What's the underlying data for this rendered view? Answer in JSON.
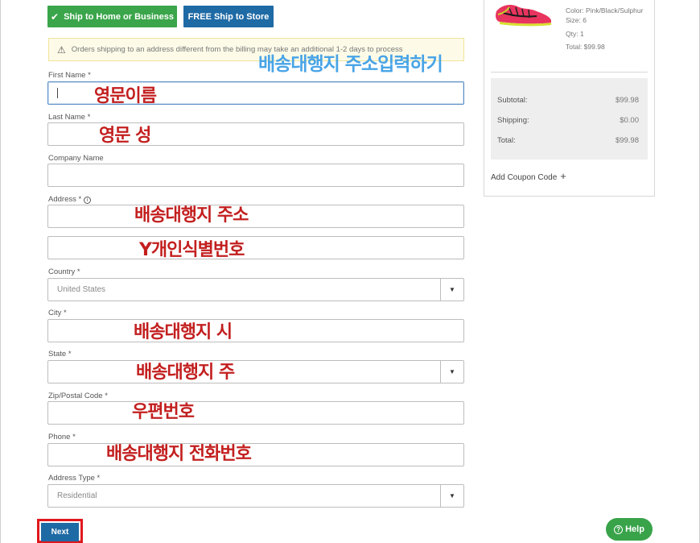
{
  "shipping_options": {
    "home_label": "Ship to Home or Business",
    "store_label": "FREE Ship to Store"
  },
  "notice": {
    "text": "Orders shipping to an address different from the billing may take an additional 1-2 days to process"
  },
  "form": {
    "first_name_label": "First Name *",
    "last_name_label": "Last Name *",
    "company_label": "Company Name",
    "address_label": "Address *",
    "country_label": "Country *",
    "country_value": "United States",
    "city_label": "City *",
    "state_label": "State *",
    "zip_label": "Zip/Postal Code *",
    "phone_label": "Phone *",
    "address_type_label": "Address Type *",
    "address_type_value": "Residential",
    "next_label": "Next"
  },
  "annotations": {
    "heading": "배송대행지 주소입력하기",
    "first_name": "영문이름",
    "last_name": "영문 성",
    "address": "배송대행지 주소",
    "address2": "Y개인식별번호",
    "city": "배송대행지 시",
    "state": "배송대행지 주",
    "zip": "우편번호",
    "phone": "배송대행지 전화번호"
  },
  "summary": {
    "product": {
      "color": "Color: Pink/Black/Sulphur",
      "size": "Size: 6",
      "qty": "Qty: 1",
      "total": "Total: $99.98"
    },
    "subtotal_label": "Subtotal:",
    "subtotal_value": "$99.98",
    "shipping_label": "Shipping:",
    "shipping_value": "$0.00",
    "total_label": "Total:",
    "total_value": "$99.98",
    "coupon_label": "Add Coupon Code"
  },
  "help": {
    "label": "Help"
  },
  "colors": {
    "green": "#3aa54a",
    "blue": "#1e6aa5",
    "annotation_red": "#c31f1f",
    "annotation_blue": "#49a4e6",
    "highlight_red": "#e0181d"
  }
}
